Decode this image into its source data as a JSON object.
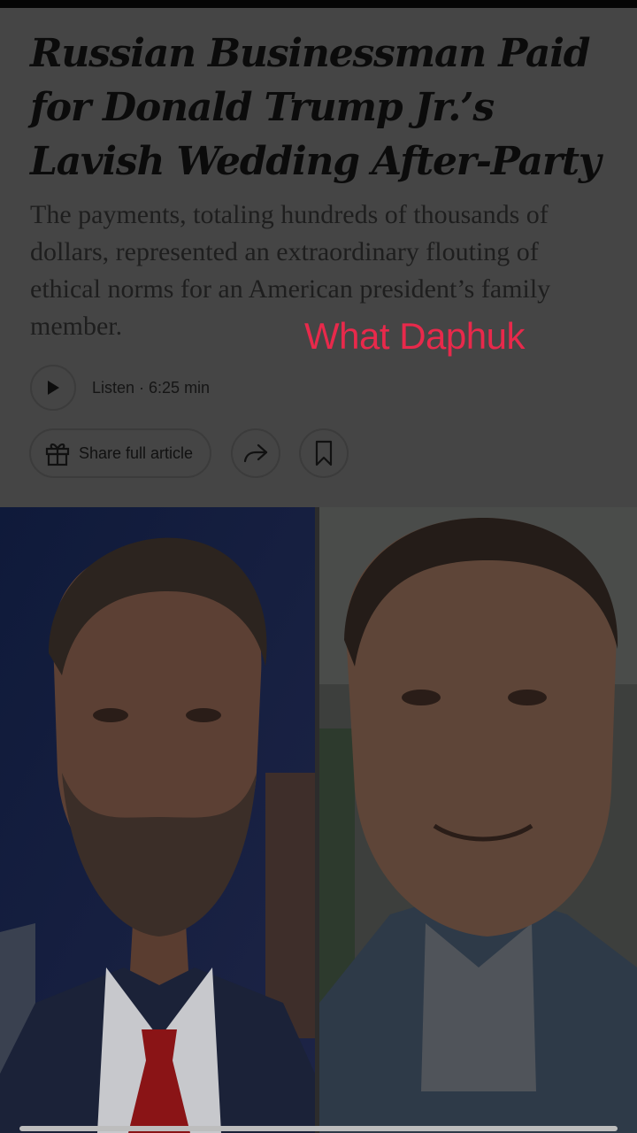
{
  "article": {
    "headline": "Russian Businessman Paid for Donald Trump Jr.’s Lavish Wedding After-Party",
    "summary": "The payments, totaling hundreds of thousands of dollars, represented an extraordinary flouting of ethical norms for an American president’s family member."
  },
  "overlay": {
    "caption": "What Daphuk"
  },
  "audio": {
    "listen_label": "Listen · 6:25 min"
  },
  "actions": {
    "share_label": "Share full article",
    "icons": [
      "play-icon",
      "gift-icon",
      "share-arrow-icon",
      "bookmark-icon"
    ]
  },
  "colors": {
    "page_dim_background": "#454545",
    "caption_color": "#e8294b",
    "left_photo_backdrop": "#141a2e"
  }
}
